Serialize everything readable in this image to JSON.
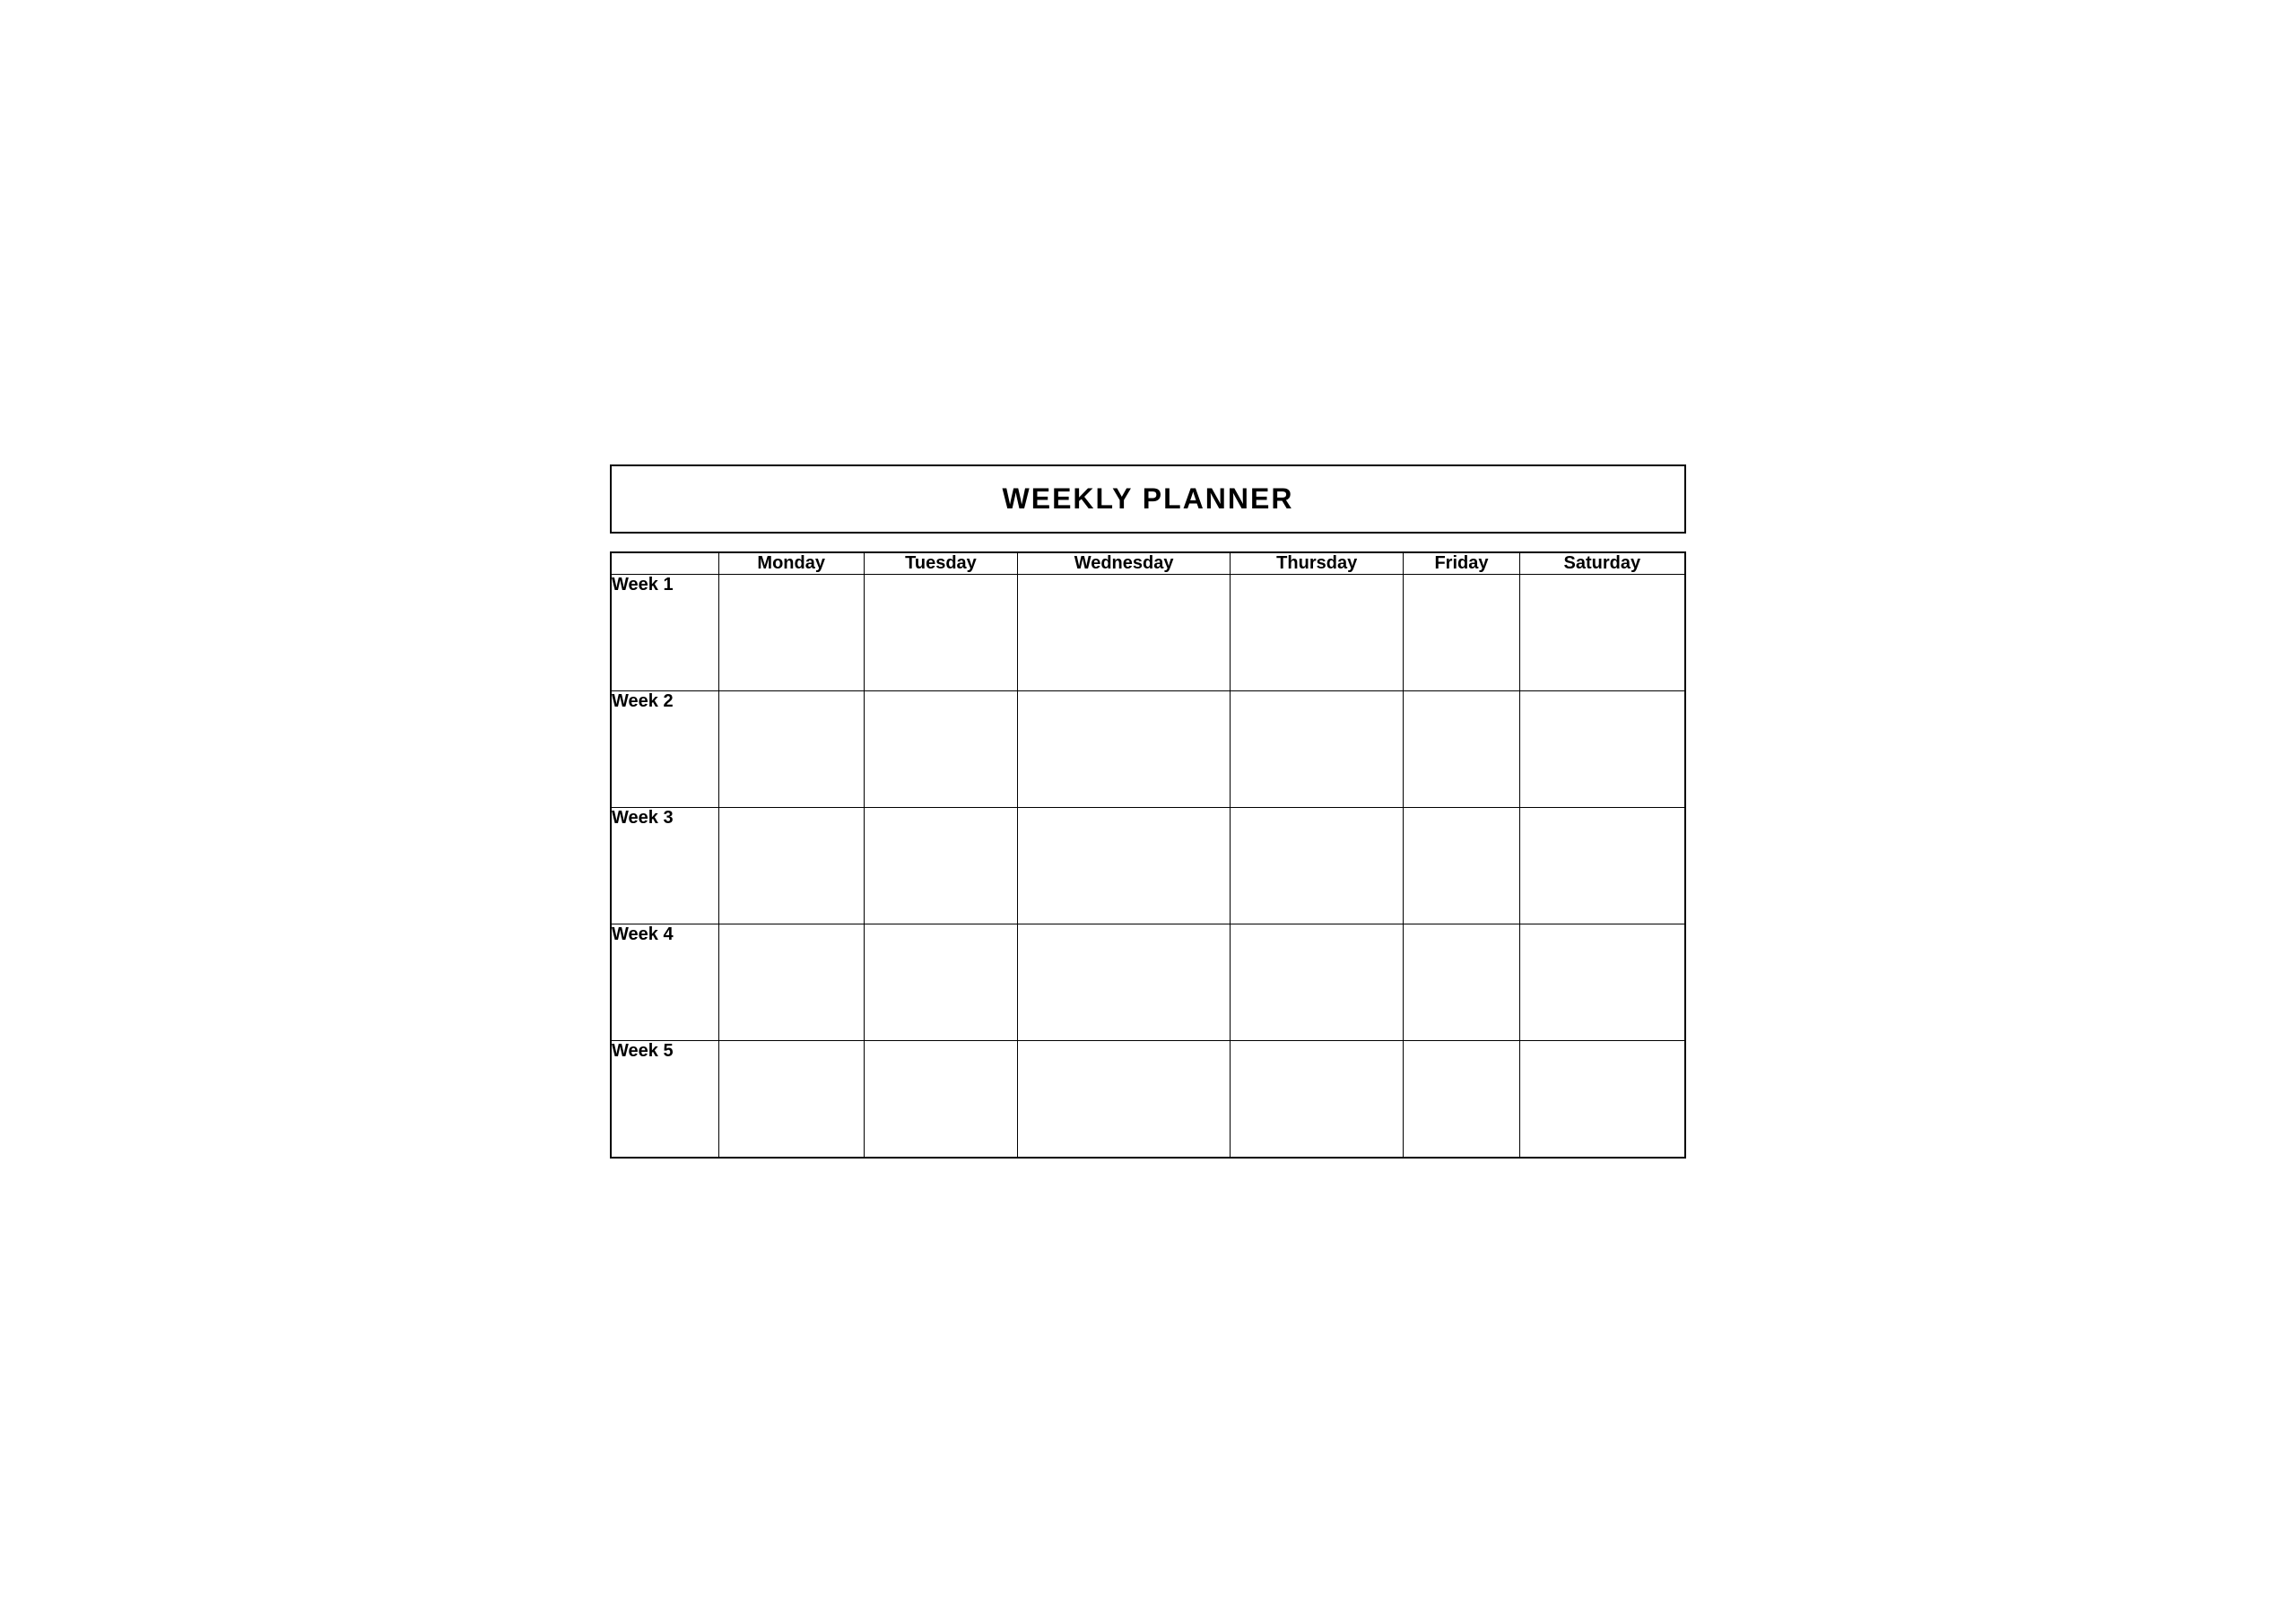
{
  "title": "WEEKLY PLANNER",
  "columns": {
    "empty": "",
    "days": [
      "Monday",
      "Tuesday",
      "Wednesday",
      "Thursday",
      "Friday",
      "Saturday"
    ]
  },
  "rows": [
    {
      "label": "Week 1"
    },
    {
      "label": "Week 2"
    },
    {
      "label": "Week 3"
    },
    {
      "label": "Week 4"
    },
    {
      "label": "Week 5"
    }
  ]
}
